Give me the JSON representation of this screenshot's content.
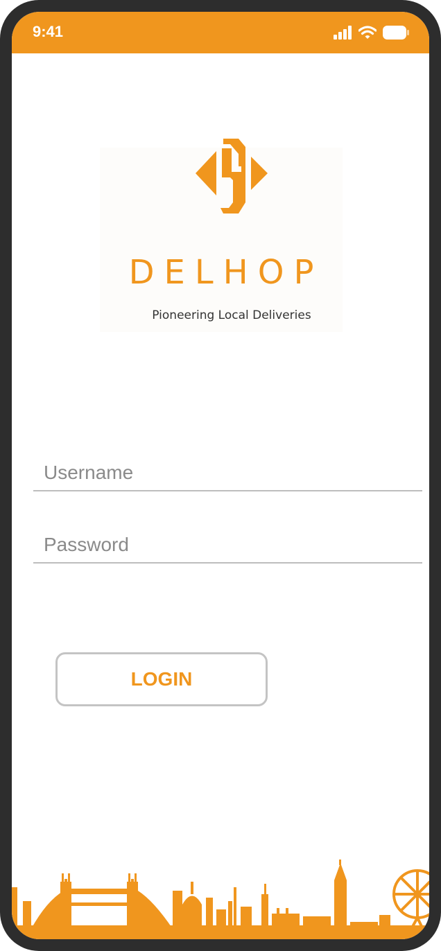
{
  "status_bar": {
    "time": "9:41",
    "icons": [
      "signal-icon",
      "wifi-icon",
      "battery-icon"
    ]
  },
  "brand": {
    "name": "DELHOP",
    "tagline": "Pioneering Local Deliveries",
    "accent_color": "#f0961e"
  },
  "login_form": {
    "username_placeholder": "Username",
    "username_value": "",
    "password_placeholder": "Password",
    "password_value": "",
    "login_label": "LOGIN"
  },
  "footer": {
    "illustration": "london-skyline-silhouette"
  }
}
